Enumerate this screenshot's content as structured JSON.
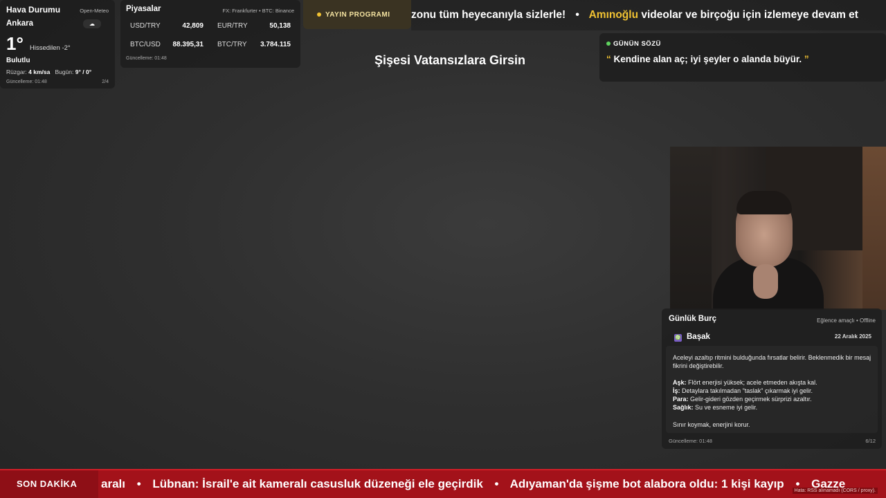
{
  "weather": {
    "title": "Hava Durumu",
    "source": "Open-Meteo",
    "city": "Ankara",
    "cloud_icon": "☁",
    "temp": "1°",
    "feels_like": "Hissedilen -2°",
    "condition": "Bulutlu",
    "wind_label": "Rüzgar:",
    "wind_value": "4 km/sa",
    "today_label": "Bugün:",
    "today_value": "9° / 0°",
    "updated": "Güncelleme: 01:48",
    "page": "2/4"
  },
  "markets": {
    "title": "Piyasalar",
    "source": "FX: Frankfurter • BTC: Binance",
    "items": [
      {
        "label": "USD/TRY",
        "value": "42,809"
      },
      {
        "label": "EUR/TRY",
        "value": "50,138"
      },
      {
        "label": "BTC/USD",
        "value": "88.395,31"
      },
      {
        "label": "BTC/TRY",
        "value": "3.784.115"
      }
    ],
    "updated": "Güncelleme: 01:48"
  },
  "schedule": {
    "label": "YAYIN PROGRAMI"
  },
  "top_ticker": {
    "part1": "zonu tüm heyecanıyla sizlerle!",
    "separator": "•",
    "highlight": "Amınoğlu",
    "part2": "videolar ve birçoğu için izlemeye devam et"
  },
  "stream_title": "Şişesi Vatansızlara Girsin",
  "quote": {
    "heading": "GÜNÜN SÖZÜ",
    "open_mark": "“",
    "text": "Kendine alan aç; iyi şeyler o alanda büyür.",
    "close_mark": "”"
  },
  "horoscope": {
    "title": "Günlük Burç",
    "tag": "Eğlence amaçlı • Offline",
    "sign_icon": "♍",
    "sign": "Başak",
    "date": "22 Aralık 2025",
    "summary": "Aceleyi azaltıp ritmini bulduğunda fırsatlar belirir. Beklenmedik bir mesaj fikrini değiştirebilir.",
    "love_label": "Aşk:",
    "love": "Flört enerjisi yüksek; acele etmeden akışta kal.",
    "work_label": "İş:",
    "work": "Detaylara takılmadan \"taslak\" çıkarmak iyi gelir.",
    "money_label": "Para:",
    "money": "Gelir-gideri gözden geçirmek sürprizi azaltır.",
    "health_label": "Sağlık:",
    "health": "Su ve esneme iyi gelir.",
    "tip": "Sınır koymak, enerjini korur.",
    "updated": "Güncelleme: 01:48",
    "page": "6/12"
  },
  "breaking": {
    "label": "SON DAKİKA",
    "separator": "•",
    "items": [
      "aralı",
      "Lübnan: İsrail'e ait kameralı casusluk düzeneği ele geçirdik",
      "Adıyaman'da şişme bot alabora oldu: 1 kişi kayıp",
      "Gazze"
    ],
    "error": "Hata: RSS alınamadı (CORS / proxy)."
  },
  "colors": {
    "accent_yellow": "#f1c232",
    "breaking_red": "#a3121a",
    "quote_green": "#5fd35f"
  }
}
